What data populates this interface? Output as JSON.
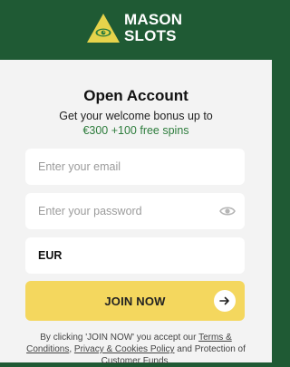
{
  "brand": {
    "name_line1": "MASON",
    "name_line2": "SLOTS",
    "icon": "pyramid-eye-icon",
    "colors": {
      "triangle": "#e6d34b",
      "eye": "#2e7d3d"
    }
  },
  "form": {
    "title": "Open Account",
    "subtitle": "Get your welcome bonus up to",
    "bonus": "€300 +100 free spins",
    "email_placeholder": "Enter your email",
    "password_placeholder": "Enter your password",
    "currency_value": "EUR",
    "join_label": "JOIN NOW",
    "password_toggle_icon": "eye-icon",
    "join_arrow_icon": "arrow-right-icon"
  },
  "terms": {
    "prefix": "By clicking 'JOIN NOW' you accept our ",
    "terms_link": "Terms & Conditions",
    "sep": ", ",
    "privacy_link": "Privacy & Cookies Policy",
    "suffix": " and Protection of Customer Funds."
  },
  "colors": {
    "background": "#1f5a34",
    "card": "#f3f3f3",
    "accent_green": "#2e7d3d",
    "join_button": "#f4d75e"
  }
}
